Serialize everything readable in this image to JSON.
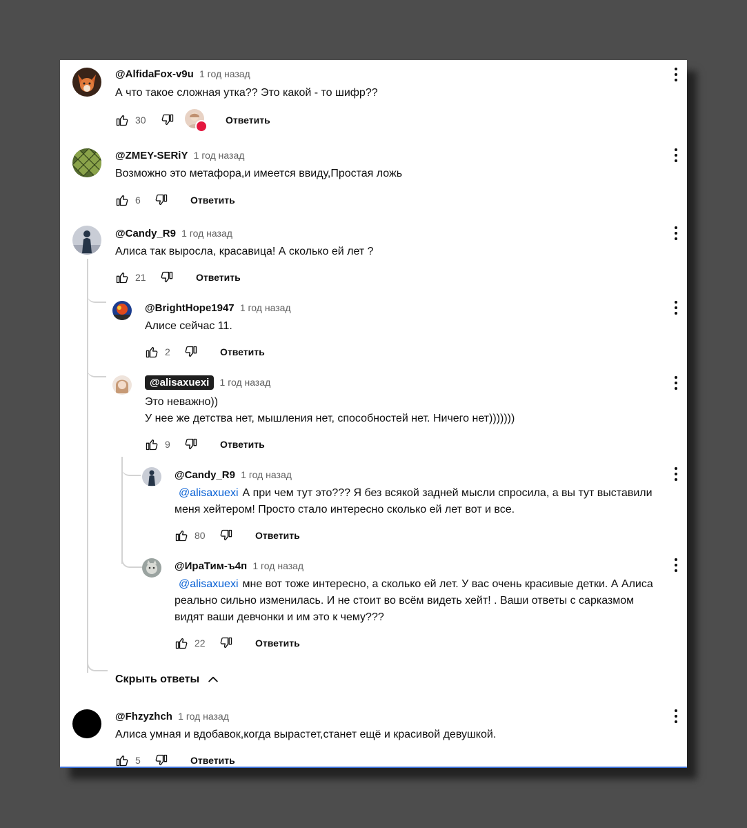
{
  "comments": [
    {
      "author": "@AlfidaFox-v9u",
      "time": "1 год назад",
      "lines": [
        "А что такое сложная утка?? Это какой - то шифр??"
      ],
      "likes": "30",
      "reply": "Ответить",
      "avatar": "fox-avatar"
    },
    {
      "author": "@ZMEY-SERiY",
      "time": "1 год назад",
      "lines": [
        "Возможно это метафора,и имеется ввиду,Простая ложь"
      ],
      "likes": "6",
      "reply": "Ответить",
      "avatar": "snake-scale-avatar"
    },
    {
      "author": "@Candy_R9",
      "time": "1 год назад",
      "lines": [
        "Алиса так выросла, красавица! А сколько ей лет ?"
      ],
      "likes": "21",
      "reply": "Ответить",
      "avatar": "silhouette-avatar"
    },
    {
      "author": "@BrightHope1947",
      "time": "1 год назад",
      "lines": [
        "Алисе сейчас 11."
      ],
      "likes": "2",
      "reply": "Ответить",
      "avatar": "colorful-avatar"
    },
    {
      "author": "@alisaxuexi",
      "time": "1 год назад",
      "lines": [
        "Это неважно))",
        "У нее же детства нет, мышления нет, способностей нет. Ничего нет)))))))"
      ],
      "likes": "9",
      "reply": "Ответить",
      "avatar": "girl-avatar"
    },
    {
      "author": "@Candy_R9",
      "time": "1 год назад",
      "mention": "@alisaxuexi",
      "lines": [
        "А при чем тут это??? Я без всякой задней мысли спросила, а вы тут выставили",
        "меня хейтером! Просто стало интересно сколько ей лет вот и все."
      ],
      "likes": "80",
      "reply": "Ответить",
      "avatar": "silhouette-avatar"
    },
    {
      "author": "@ИраТим-ъ4п",
      "time": "1 год назад",
      "mention": "@alisaxuexi",
      "lines": [
        "мне вот тоже интересно, а сколько ей лет. У вас очень красивые детки. А Алиса",
        "реально сильно изменилась. И не стоит во всём видеть хейт! . Ваши  ответы с сарказмом",
        "видят ваши девчонки и им это к чему???"
      ],
      "likes": "22",
      "reply": "Ответить",
      "avatar": "cat-avatar"
    },
    {
      "author": "@Fhzyzhch",
      "time": "1 год назад",
      "lines": [
        "Алиса умная и вдобавок,когда вырастет,станет ещё и красивой девушкой."
      ],
      "likes": "5",
      "reply": "Ответить",
      "avatar": "black-circle-avatar"
    }
  ],
  "hide_replies_label": "Скрыть ответы",
  "colors": {
    "mention": "#065fd4",
    "background": "#4d4d4d",
    "heart": "#e4173f"
  }
}
